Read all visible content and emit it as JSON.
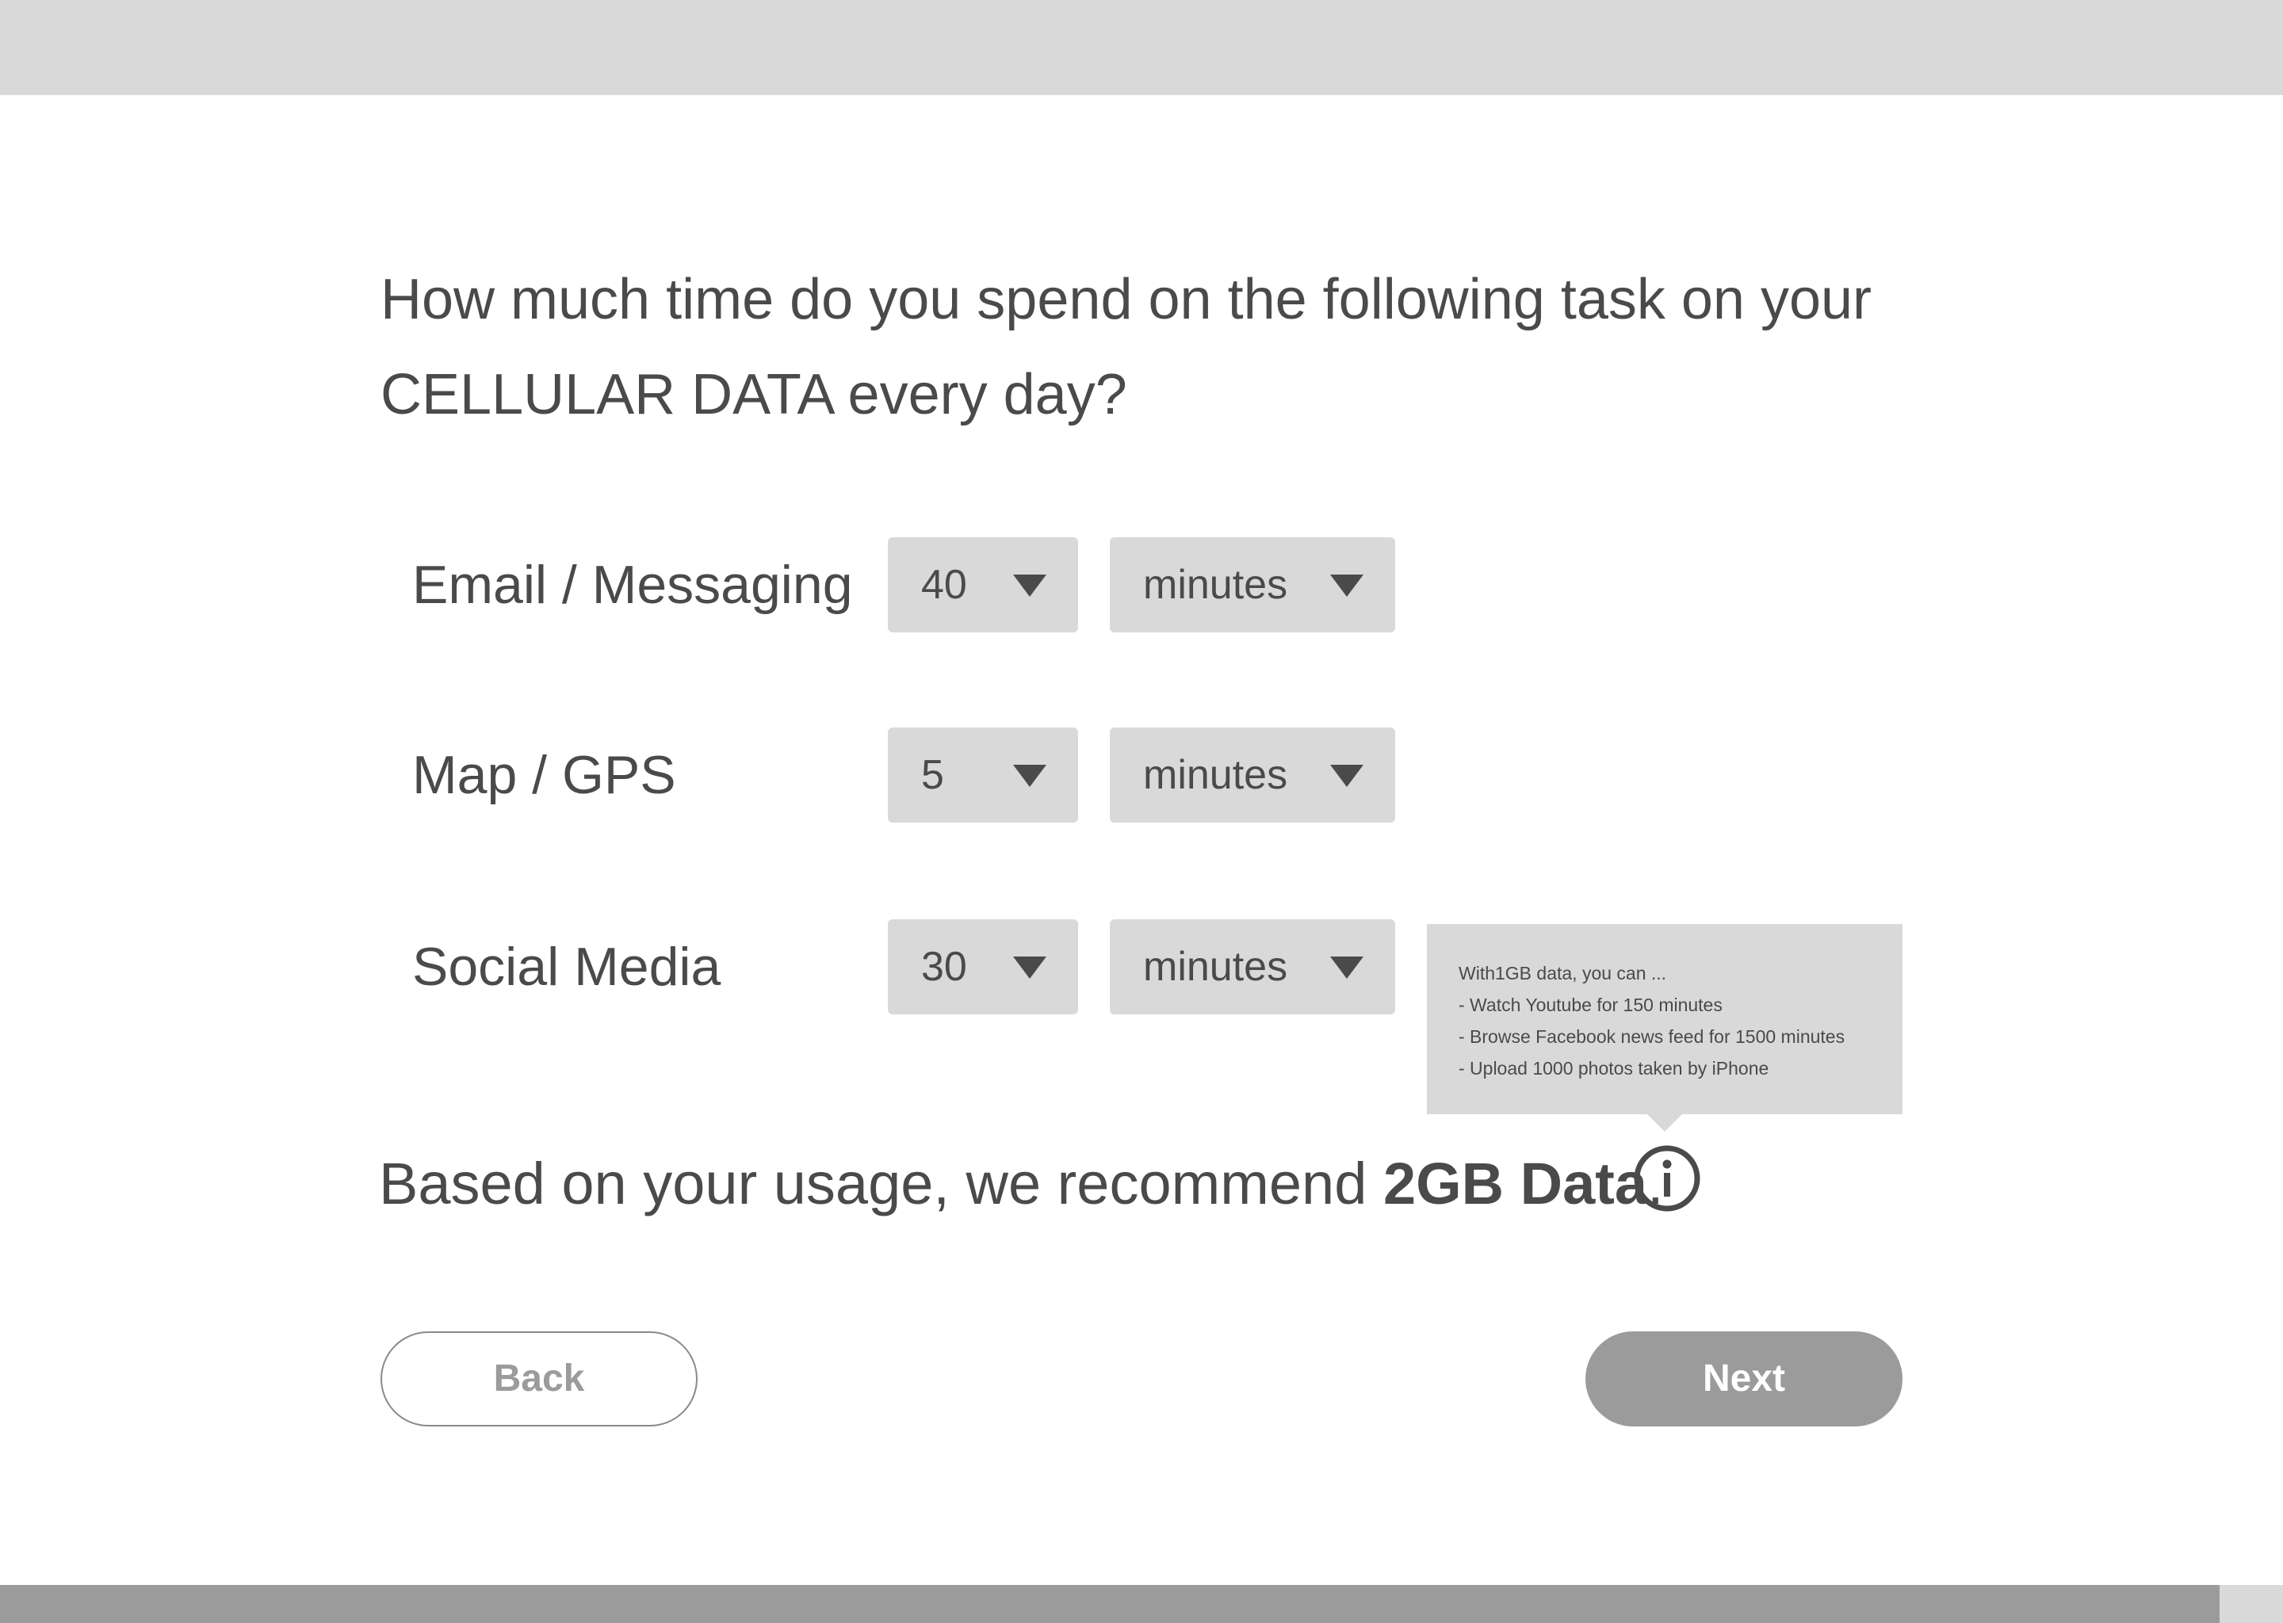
{
  "question": {
    "line1": "How much time do you spend on the following task on your",
    "line2": "CELLULAR DATA every day?"
  },
  "tasks": [
    {
      "label": "Email / Messaging",
      "amount": "40",
      "unit": "minutes"
    },
    {
      "label": "Map / GPS",
      "amount": "5",
      "unit": "minutes"
    },
    {
      "label": "Social Media",
      "amount": "30",
      "unit": "minutes"
    }
  ],
  "tooltip": {
    "lines": [
      "With1GB data, you can ...",
      "- Watch Youtube for 150 minutes",
      "- Browse Facebook news feed for 1500 minutes",
      "- Upload 1000 photos taken by iPhone"
    ]
  },
  "recommendation": {
    "prefix": "Based on your usage, we recommend ",
    "value": "2GB Data",
    "suffix": "."
  },
  "icons": {
    "info": "info-icon",
    "dropdown": "caret-down-icon"
  },
  "buttons": {
    "back": "Back",
    "next": "Next"
  },
  "colors": {
    "text": "#4a4a4a",
    "panel": "#d9d9d9",
    "button": "#9b9b9b",
    "background": "#ffffff"
  }
}
